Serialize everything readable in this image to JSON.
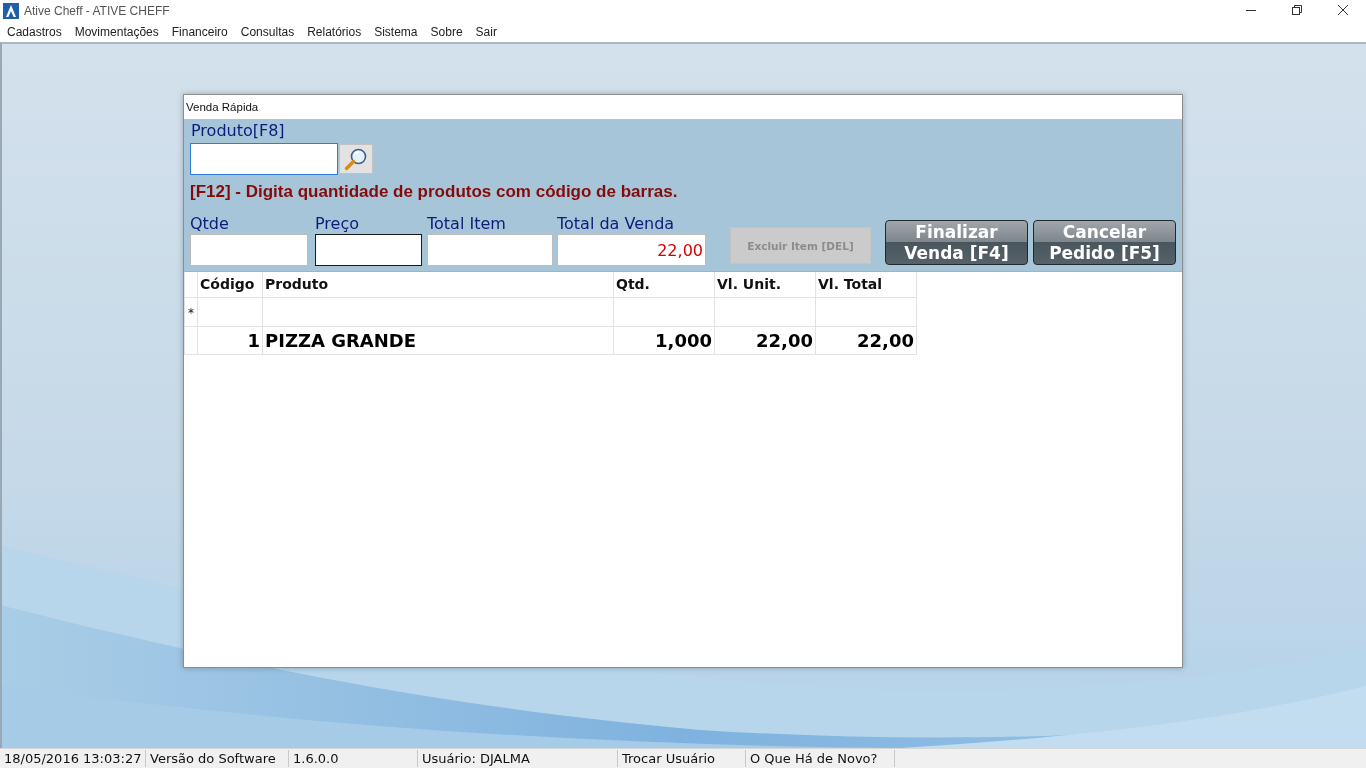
{
  "app_window": {
    "title": "Ative Cheff - ATIVE CHEFF"
  },
  "menu": [
    "Cadastros",
    "Movimentações",
    "Financeiro",
    "Consultas",
    "Relatórios",
    "Sistema",
    "Sobre",
    "Sair"
  ],
  "dialog": {
    "title": "Venda Rápida",
    "product_field": {
      "label": "Produto[F8]",
      "hovered": true
    },
    "hint": "[F12] - Digita quantidade de produtos com código de barras.",
    "fields": [
      {
        "label": "Qtde",
        "focused": false
      },
      {
        "label": "Preço",
        "focused": true
      },
      {
        "label": "Total Item",
        "focused": false
      },
      {
        "label": "Total da Venda",
        "focused": false,
        "value": "22,00"
      }
    ],
    "buttons": [
      {
        "kind": "flat",
        "label_lines": [
          "Excluir Item [DEL]"
        ],
        "disabled": true
      },
      {
        "kind": "glossy",
        "label_lines": [
          "Finalizar",
          "Venda [F4]"
        ],
        "disabled": false
      },
      {
        "kind": "glossy",
        "label_lines": [
          "Cancelar",
          "Pedido [F5]"
        ],
        "disabled": false
      }
    ],
    "grid": {
      "columns": [
        "Código",
        "Produto",
        "Qtd.",
        "Vl. Unit.",
        "Vl. Total"
      ],
      "rows": [
        {
          "kind": "new",
          "marker": "*"
        },
        {
          "kind": "item",
          "cells": [
            "1",
            "PIZZA GRANDE",
            "1,000",
            "22,00",
            "22,00"
          ]
        }
      ]
    }
  },
  "status_bar": [
    "18/05/2016 13:03:27",
    "Versão do Software",
    "1.6.0.0",
    "Usuário: DJALMA",
    "Trocar Usuário",
    "O Que Há de Novo?"
  ]
}
